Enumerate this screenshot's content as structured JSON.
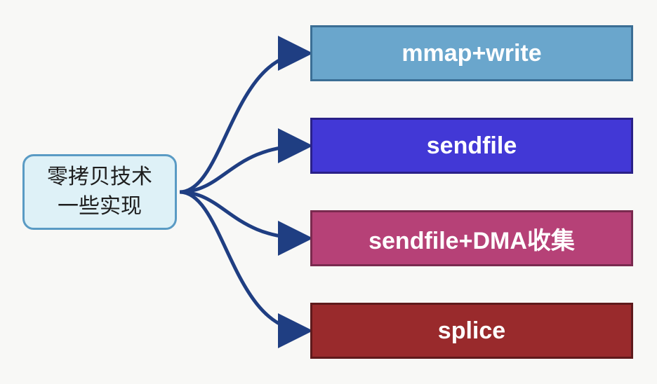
{
  "source": {
    "label": "零拷贝技术\n一些实现"
  },
  "targets": [
    {
      "label": "mmap+write",
      "fill": "#6aa6cc",
      "border": "#3b6e95"
    },
    {
      "label": "sendfile",
      "fill": "#4238d6",
      "border": "#2a2188"
    },
    {
      "label": "sendfile+DMA收集",
      "fill": "#b64177",
      "border": "#7a2a4f"
    },
    {
      "label": "splice",
      "fill": "#992a2c",
      "border": "#5f1a1c"
    }
  ],
  "arrowColor": "#1f3e82"
}
